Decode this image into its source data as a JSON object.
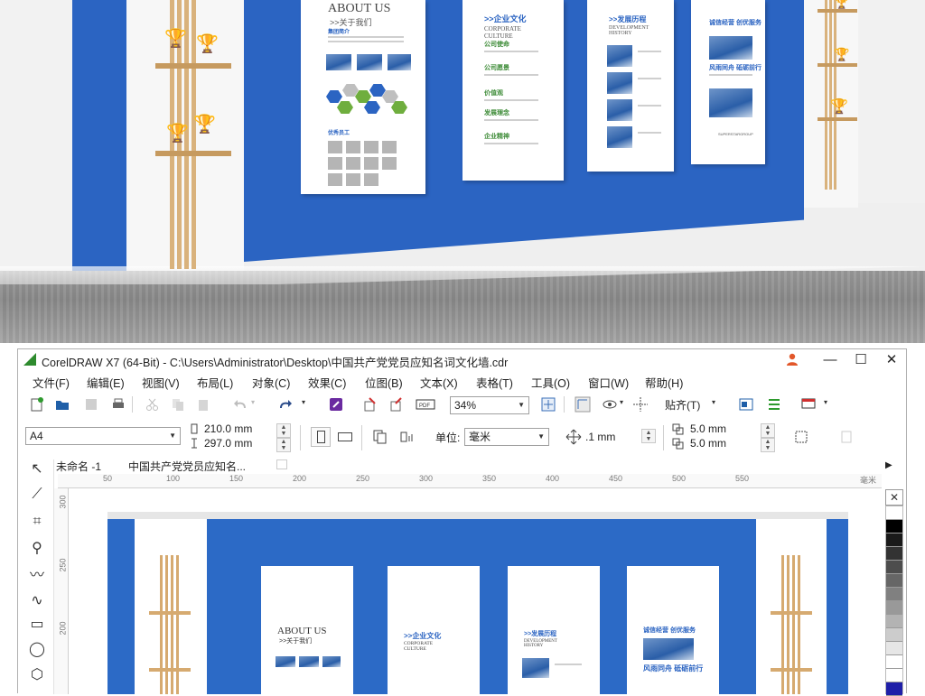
{
  "render": {
    "panels": [
      {
        "title": "ABOUT US",
        "subtitle": ">>关于我们",
        "labels": [
          "集团简介",
          "优秀员工"
        ]
      },
      {
        "title": ">>企业文化",
        "subtitle": "CORPORATE CULTURE",
        "labels": [
          "公司使命",
          "公司愿景",
          "价值观",
          "发展理念",
          "企业精神"
        ]
      },
      {
        "title": ">>发展历程",
        "subtitle": "DEVELOPMENT HISTORY",
        "labels": []
      },
      {
        "title": "诚信经营  创优服务",
        "subtitle": "风雨同舟  砥砺前行",
        "labels": [
          "SUPERSTARGROUP"
        ]
      }
    ]
  },
  "window": {
    "title": "CorelDRAW X7 (64-Bit) - C:\\Users\\Administrator\\Desktop\\中国共产党党员应知名词文化墙.cdr",
    "controls": {
      "minimize": "—",
      "maximize": "☐",
      "close": "✕"
    }
  },
  "menu": [
    "文件(F)",
    "编辑(E)",
    "视图(V)",
    "布局(L)",
    "对象(C)",
    "效果(C)",
    "位图(B)",
    "文本(X)",
    "表格(T)",
    "工具(O)",
    "窗口(W)",
    "帮助(H)"
  ],
  "toolbar": {
    "zoom": "34%",
    "snap_label": "贴齐(T)"
  },
  "property_bar": {
    "page_size": "A4",
    "width": "210.0 mm",
    "height": "297.0 mm",
    "unit_label": "单位:",
    "unit": "毫米",
    "nudge": ".1 mm",
    "dup_x": "5.0 mm",
    "dup_y": "5.0 mm"
  },
  "doc_tabs": [
    "未命名 -1",
    "中国共产党党员应知名..."
  ],
  "ruler_h": [
    "50",
    "100",
    "150",
    "200",
    "250",
    "300",
    "350",
    "400",
    "450",
    "500",
    "550"
  ],
  "ruler_h_unit": "毫米",
  "ruler_v": [
    "300",
    "250",
    "200"
  ],
  "canvas_panels": [
    {
      "title": "ABOUT US",
      "subtitle": ">>关于我们"
    },
    {
      "title": ">>企业文化",
      "subtitle": "CORPORATE CULTURE"
    },
    {
      "title": ">>发展历程",
      "subtitle": "DEVELOPMENT HISTORY"
    },
    {
      "title": "诚信经营  创优服务",
      "subtitle": "风雨同舟  砥砺前行"
    }
  ],
  "palette_colors": [
    "#ffffff",
    "#000000",
    "#1a1a1a",
    "#333333",
    "#4d4d4d",
    "#666666",
    "#808080",
    "#999999",
    "#b3b3b3",
    "#cccccc",
    "#e6e6e6",
    "#ffffff",
    "#ffffff",
    "#1f1fa8"
  ],
  "colors": {
    "brand_blue": "#2b64c2",
    "wood": "#d9b27c"
  }
}
